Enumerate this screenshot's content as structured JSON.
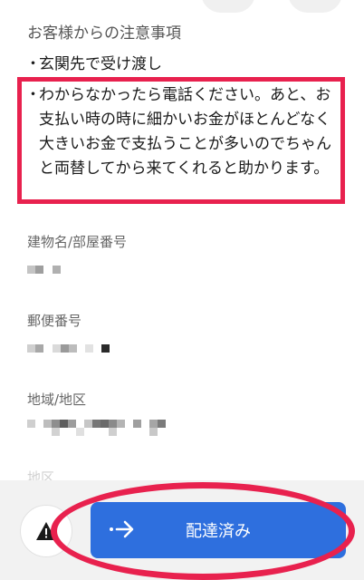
{
  "notes": {
    "heading": "お客様からの注意事項",
    "items": [
      "玄関先で受け渡し",
      "わからなかったら電話ください。あと、お支払い時の時に細かいお金がほとんどなく大きいお金で支払うことが多いのでちゃんと両替してから来てくれると助かります。"
    ],
    "bullet": "・"
  },
  "fields": [
    {
      "label": "建物名/部屋番号"
    },
    {
      "label": "郵便番号"
    },
    {
      "label": "地域/地区"
    },
    {
      "label": "地区"
    }
  ],
  "actions": {
    "delivered_label": "配達済み",
    "warning_icon": "warning-triangle-icon",
    "arrow_icon": "arrow-right-icon"
  },
  "colors": {
    "highlight": "#e8214e",
    "primary_button": "#2e6fde"
  }
}
